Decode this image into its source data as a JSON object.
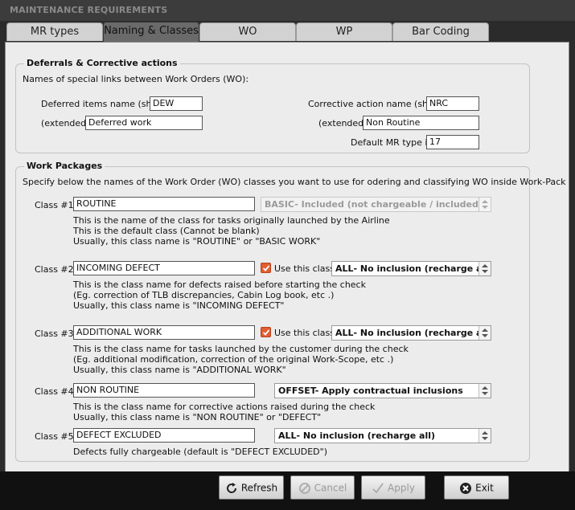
{
  "window": {
    "title": "MAINTENANCE REQUIREMENTS"
  },
  "tabs": [
    {
      "label": "MR types"
    },
    {
      "label": "Naming & Classes",
      "active": true
    },
    {
      "label": "WO"
    },
    {
      "label": "WP"
    },
    {
      "label": "Bar Coding"
    }
  ],
  "deferrals": {
    "legend": "Deferrals & Corrective actions",
    "intro": "Names of special links between Work Orders (WO):",
    "deferred_short_label": "Deferred items name (short)",
    "deferred_short_value": "DEW",
    "deferred_ext_label": "(extended)",
    "deferred_ext_value": "Deferred work",
    "corrective_short_label": "Corrective action name (short)",
    "corrective_short_value": "NRC",
    "corrective_ext_label": "(extended)",
    "corrective_ext_value": "Non Routine",
    "default_mr_label": "Default MR type id",
    "default_mr_value": "17"
  },
  "work_packages": {
    "legend": "Work Packages",
    "intro": "Specify below the names of the Work Order (WO) classes you want to use for odering and classifying WO inside Work-Pack",
    "use_label": "Use this class",
    "classes": [
      {
        "label": "Class #1",
        "value": "ROUTINE",
        "option": "BASIC- Included (not chargeable / included)",
        "desc": [
          "This is the name of the class for tasks originally launched by the Airline",
          "This is the default class (Cannot be blank)",
          "Usually, this class name is \"ROUTINE\" or \"BASIC WORK\""
        ]
      },
      {
        "label": "Class #2",
        "value": "INCOMING DEFECT",
        "option": "ALL- No inclusion (recharge all)",
        "checked": true,
        "desc": [
          "This is the class name for defects raised before starting the check",
          "(Eg. correction of TLB discrepancies, Cabin Log book, etc .)",
          "Usually, this class name is \"INCOMING DEFECT\""
        ]
      },
      {
        "label": "Class #3",
        "value": "ADDITIONAL WORK",
        "option": "ALL- No inclusion (recharge all)",
        "checked": true,
        "desc": [
          "This is the class name for tasks launched by the customer during the check",
          "(Eg. additional modification, correction of the original Work-Scope, etc .)",
          "Usually, this class name is \"ADDITIONAL WORK\""
        ]
      },
      {
        "label": "Class #4",
        "value": "NON ROUTINE",
        "option": "OFFSET- Apply contractual inclusions",
        "desc": [
          "This is the class name for corrective actions raised during the check",
          "Usually, this class name is \"NON ROUTINE\" or \"DEFECT\""
        ]
      },
      {
        "label": "Class #5",
        "value": "DEFECT EXCLUDED",
        "option": "ALL- No inclusion (recharge all)",
        "desc": [
          "Defects fully chargeable (default is \"DEFECT EXCLUDED\")"
        ]
      }
    ]
  },
  "buttons": {
    "refresh": "Refresh",
    "cancel": "Cancel",
    "apply": "Apply",
    "exit": "Exit"
  },
  "colors": {
    "checkbox": "#e25d33",
    "active_tab": "#6a6a6a",
    "panel": "#ececec"
  }
}
